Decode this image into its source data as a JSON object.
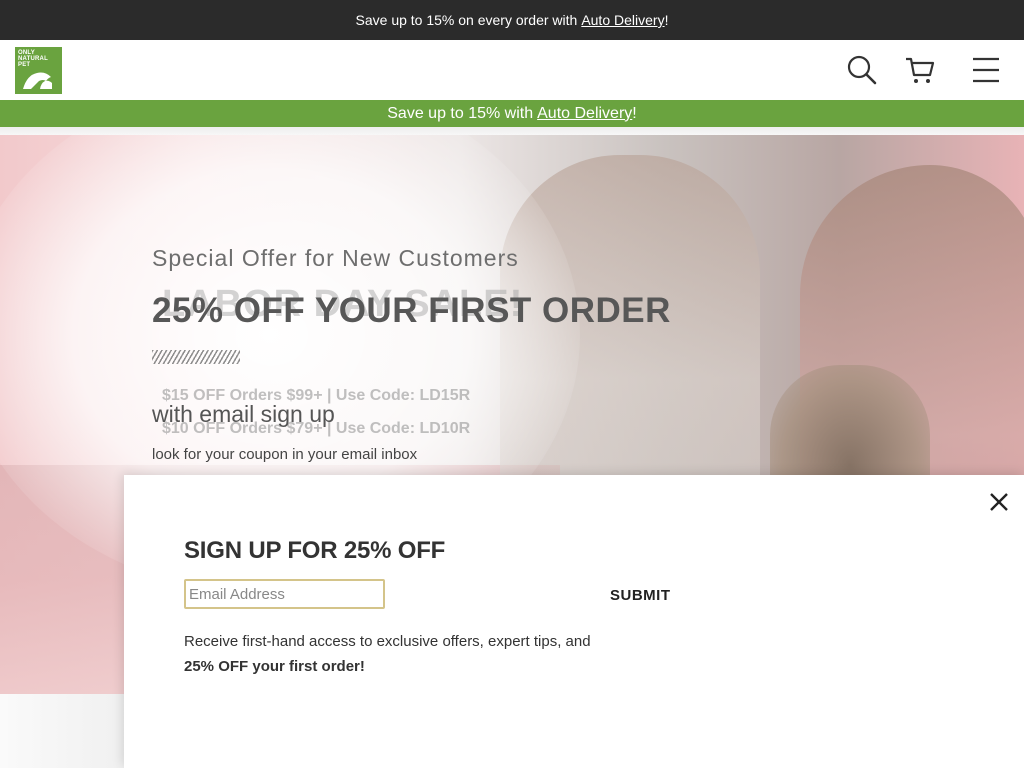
{
  "top_bar": {
    "text": "Save up to 15% on every order with",
    "link": "Auto Delivery",
    "suffix": "!"
  },
  "header": {
    "logo_text": [
      "ONLY",
      "NATURAL",
      "PET"
    ],
    "icons": [
      "search-icon",
      "cart-icon",
      "menu-icon"
    ]
  },
  "green_bar": {
    "text": "Save up to 15% with",
    "link": "Auto Delivery",
    "suffix": "!"
  },
  "hero": {
    "background_text": {
      "sale": "LABOR DAY SALE!",
      "code1": "$15 OFF Orders $99+ | Use Code: LD15R",
      "code2": "$10 OFF Orders $79+ | Use Code: LD10R"
    },
    "kicker": "Special Offer for New Customers",
    "title": "25% OFF YOUR FIRST ORDER",
    "subtitle": "with email sign up",
    "note": "look for your coupon in your email inbox"
  },
  "popup": {
    "title": "SIGN UP FOR 25% OFF",
    "email_placeholder": "Email Address",
    "submit_label": "SUBMIT",
    "desc_prefix": "Receive first-hand access to exclusive offers, expert tips, and",
    "desc_bold": "25% OFF your first order!"
  },
  "colors": {
    "top_bar_bg": "#2b2b2b",
    "brand_green": "#6aa33f",
    "input_border": "#d4c48a"
  }
}
